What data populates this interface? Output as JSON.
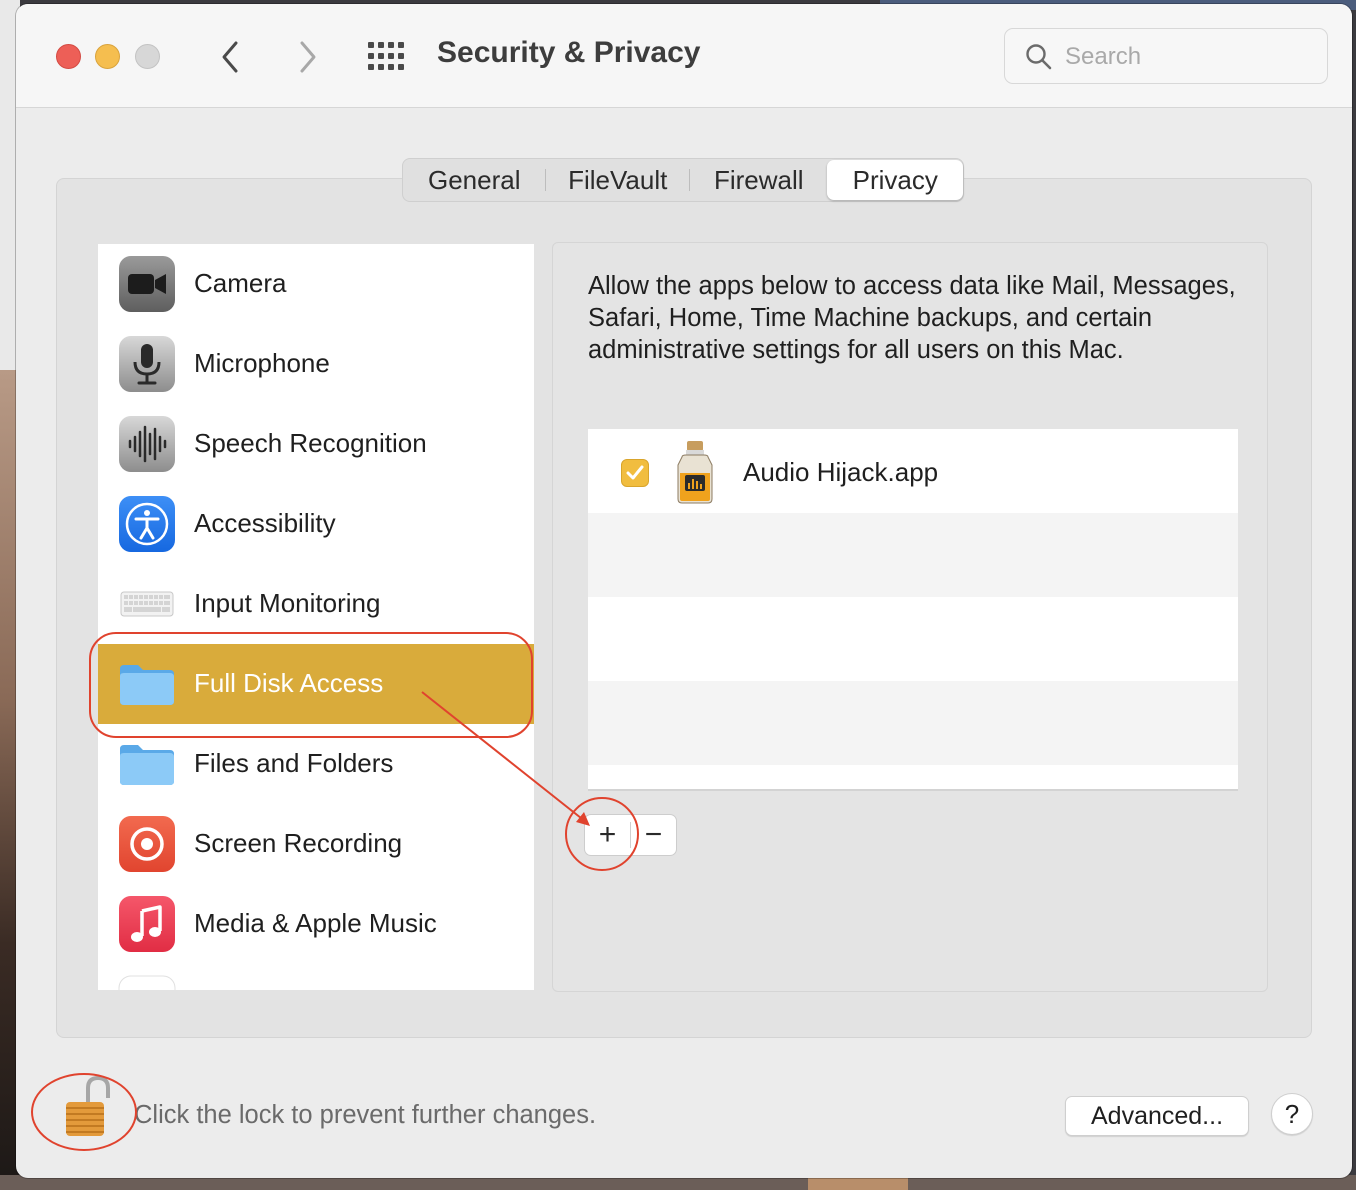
{
  "window": {
    "title": "Security & Privacy"
  },
  "toolbar": {
    "back_icon": "chevron-left-icon",
    "forward_icon": "chevron-right-icon",
    "grid_icon": "show-all-grid-icon",
    "search_placeholder": "Search"
  },
  "tabs": [
    {
      "label": "General",
      "selected": false
    },
    {
      "label": "FileVault",
      "selected": false
    },
    {
      "label": "Firewall",
      "selected": false
    },
    {
      "label": "Privacy",
      "selected": true
    }
  ],
  "sidebar": {
    "items": [
      {
        "label": "Camera",
        "icon": "camera-icon"
      },
      {
        "label": "Microphone",
        "icon": "microphone-icon"
      },
      {
        "label": "Speech Recognition",
        "icon": "waveform-icon"
      },
      {
        "label": "Accessibility",
        "icon": "accessibility-icon"
      },
      {
        "label": "Input Monitoring",
        "icon": "keyboard-icon"
      },
      {
        "label": "Full Disk Access",
        "icon": "folder-icon",
        "selected": true
      },
      {
        "label": "Files and Folders",
        "icon": "folder-icon"
      },
      {
        "label": "Screen Recording",
        "icon": "screen-recording-icon"
      },
      {
        "label": "Media & Apple Music",
        "icon": "music-note-icon"
      }
    ]
  },
  "detail": {
    "description": "Allow the apps below to access data like Mail, Messages, Safari, Home, Time Machine backups, and certain administrative settings for all users on this Mac.",
    "apps": [
      {
        "name": "Audio Hijack.app",
        "checked": true,
        "icon": "audio-hijack-jar-icon"
      }
    ],
    "add_label": "+",
    "remove_label": "−"
  },
  "footer": {
    "lock_text": "Click the lock to prevent further changes.",
    "lock_icon": "open-padlock-icon",
    "advanced_label": "Advanced...",
    "help_label": "?"
  },
  "colors": {
    "selection": "#d9ab3b",
    "checkbox": "#f1bd3f",
    "annotation": "#e0432e"
  }
}
